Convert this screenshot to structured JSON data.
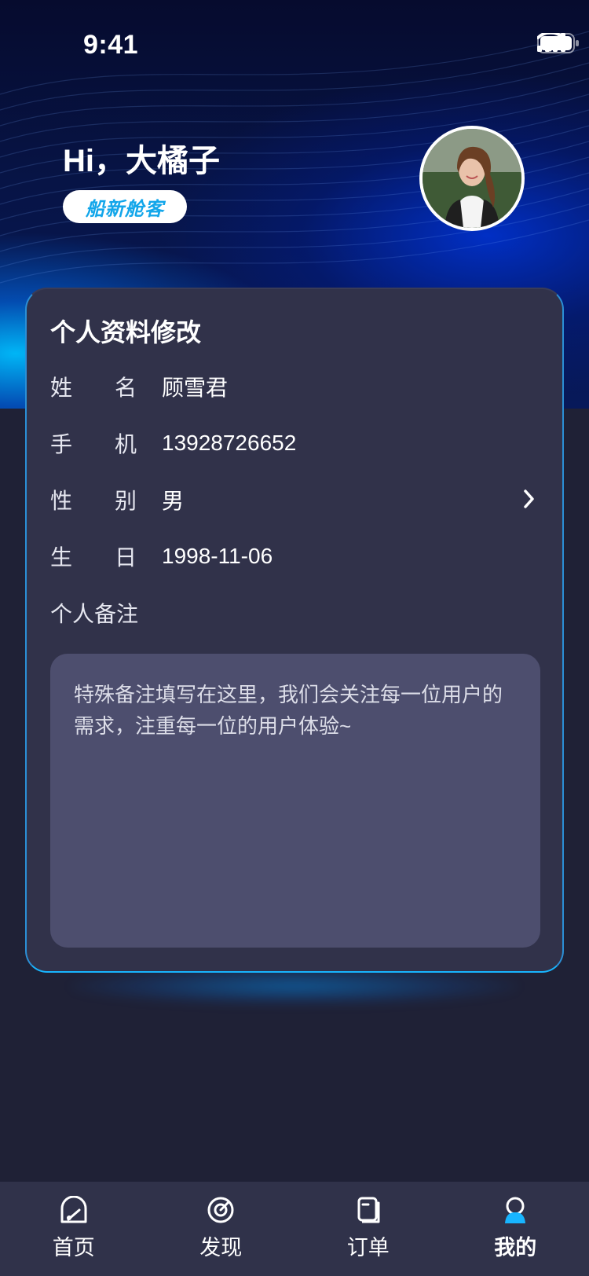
{
  "status_bar": {
    "time": "9:41"
  },
  "header": {
    "greeting": "Hi，大橘子",
    "badge": "船新舱客"
  },
  "profile_card": {
    "title": "个人资料修改",
    "rows": [
      {
        "label_a": "姓",
        "label_b": "名",
        "value": "顾雪君"
      },
      {
        "label_a": "手",
        "label_b": "机",
        "value": "13928726652"
      },
      {
        "label_a": "性",
        "label_b": "别",
        "value": "男"
      },
      {
        "label_a": "生",
        "label_b": "日",
        "value": "1998-11-06"
      }
    ],
    "remark_label": "个人备注",
    "remark_text": "特殊备注填写在这里，我们会关注每一位用户的需求，注重每一位的用户体验~"
  },
  "tabbar": {
    "items": [
      {
        "label": "首页",
        "icon": "home-icon"
      },
      {
        "label": "发现",
        "icon": "discover-icon"
      },
      {
        "label": "订单",
        "icon": "order-icon"
      },
      {
        "label": "我的",
        "icon": "profile-icon",
        "active": true
      }
    ]
  },
  "colors": {
    "accent": "#18b5ff",
    "card_bg": "#31324a",
    "page_bg": "#1f2136"
  }
}
